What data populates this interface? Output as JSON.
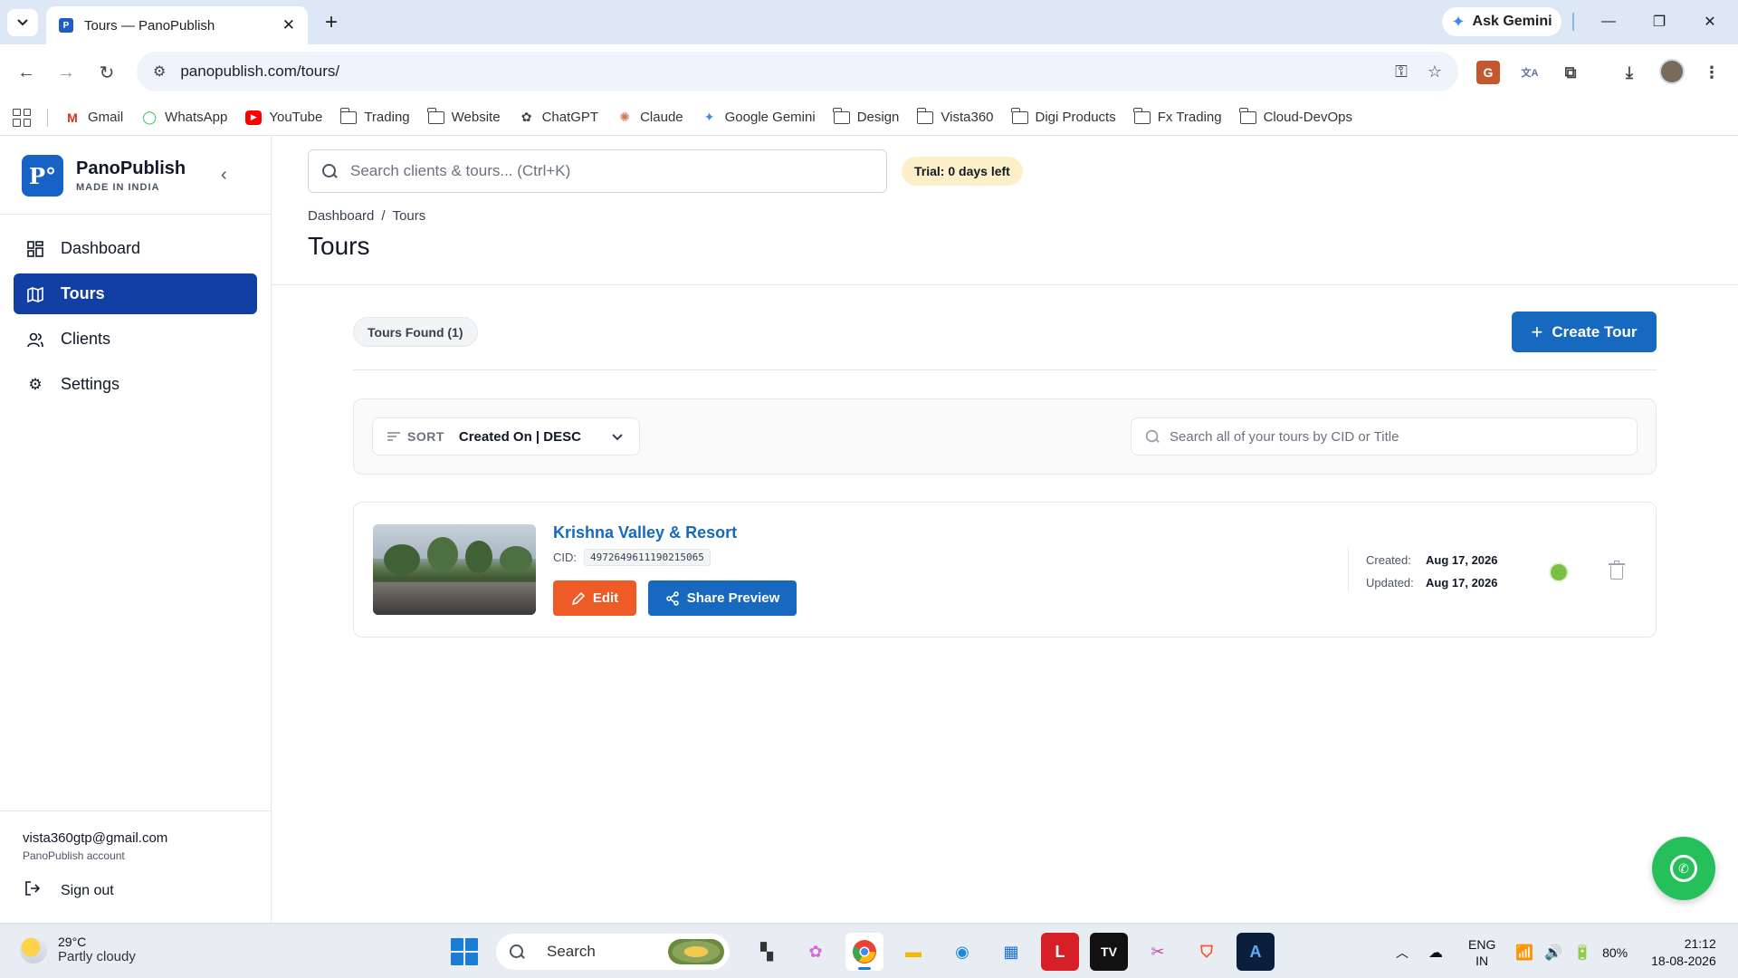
{
  "browser": {
    "tab_title": "Tours — PanoPublish",
    "tab_favicon": "P",
    "ask_gemini": "Ask Gemini",
    "url": "panopublish.com/tours/",
    "bookmarks": [
      {
        "label": "Gmail",
        "icon": "gmail-icon"
      },
      {
        "label": "WhatsApp",
        "icon": "whatsapp-icon"
      },
      {
        "label": "YouTube",
        "icon": "youtube-icon"
      },
      {
        "label": "Trading",
        "icon": "folder-icon"
      },
      {
        "label": "Website",
        "icon": "folder-icon"
      },
      {
        "label": "ChatGPT",
        "icon": "chatgpt-icon"
      },
      {
        "label": "Claude",
        "icon": "claude-icon"
      },
      {
        "label": "Google Gemini",
        "icon": "gemini-icon"
      },
      {
        "label": "Design",
        "icon": "folder-icon"
      },
      {
        "label": "Vista360",
        "icon": "folder-icon"
      },
      {
        "label": "Digi Products",
        "icon": "folder-icon"
      },
      {
        "label": "Fx Trading",
        "icon": "folder-icon"
      },
      {
        "label": "Cloud-DevOps",
        "icon": "folder-icon"
      }
    ]
  },
  "sidebar": {
    "brand_name": "PanoPublish",
    "brand_tagline": "MADE IN INDIA",
    "logo_text": "P°",
    "nav": [
      {
        "label": "Dashboard",
        "icon": "dashboard-grid-icon",
        "active": false
      },
      {
        "label": "Tours",
        "icon": "map-icon",
        "active": true
      },
      {
        "label": "Clients",
        "icon": "users-icon",
        "active": false
      },
      {
        "label": "Settings",
        "icon": "gear-icon",
        "active": false
      }
    ],
    "account_email": "vista360gtp@gmail.com",
    "account_sub": "PanoPublish account",
    "sign_out": "Sign out"
  },
  "header": {
    "search_placeholder": "Search clients & tours... (Ctrl+K)",
    "trial_badge": "Trial: 0 days left",
    "breadcrumb": [
      "Dashboard",
      "/",
      "Tours"
    ],
    "title": "Tours"
  },
  "toolbar": {
    "tours_found": "Tours Found (1)",
    "create_tour": "Create Tour"
  },
  "filters": {
    "sort_label": "SORT",
    "sort_value": "Created On | DESC",
    "search_placeholder": "Search all of your tours by CID or Title"
  },
  "tours": [
    {
      "title": "Krishna Valley & Resort",
      "cid_label": "CID:",
      "cid": "4972649611190215065",
      "edit_label": "Edit",
      "share_label": "Share Preview",
      "created_label": "Created:",
      "created": "Aug 17, 2026",
      "updated_label": "Updated:",
      "updated": "Aug 17, 2026",
      "status_color": "#7bc043"
    }
  ],
  "taskbar": {
    "temp": "29°C",
    "weather": "Partly cloudy",
    "search": "Search",
    "lang_top": "ENG",
    "lang_bottom": "IN",
    "battery": "80%",
    "time": "21:12",
    "date": "18-08-2026"
  },
  "colors": {
    "primary": "#1769c0",
    "nav_active": "#123fa3",
    "edit": "#ef5b26",
    "whatsapp": "#25c05a"
  }
}
